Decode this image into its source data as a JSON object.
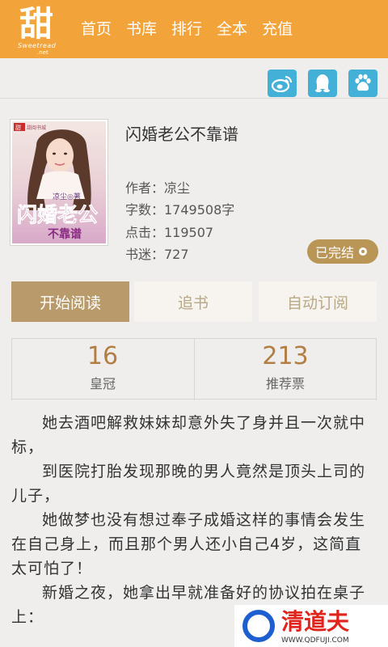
{
  "header": {
    "logo_text": "甜",
    "logo_sub": "Sweetread",
    "logo_sub2": ".net",
    "nav": [
      "首页",
      "书库",
      "排行",
      "全本",
      "充值"
    ]
  },
  "share_icons": [
    "weibo-icon",
    "qq-icon",
    "baidu-icon"
  ],
  "book": {
    "title": "闪婚老公不靠谱",
    "cover_author": "凉尘◎著",
    "cover_title_line1": "闪婚老公",
    "cover_title_line2": "不靠谱",
    "author": "作者：凉尘",
    "words": "字数：1749508字",
    "clicks": "点击：119507",
    "fans": "书迷：727",
    "status": "已完结"
  },
  "actions": {
    "read": "开始阅读",
    "follow": "追书",
    "auto_subscribe": "自动订阅"
  },
  "stats": [
    {
      "value": "16",
      "label": "皇冠"
    },
    {
      "value": "213",
      "label": "推荐票"
    }
  ],
  "intro": [
    "她去酒吧解救妹妹却意外失了身并且一次就中标，",
    "到医院打胎发现那晚的男人竟然是顶头上司的儿子，",
    "她做梦也没有想过奉子成婚这样的事情会发生在自己身上，而且那个男人还小自己4岁，这简直太可怕了！",
    "新婚之夜，她拿出早就准备好的协议拍在桌子上："
  ],
  "watermark": {
    "text": "清道夫",
    "url": "WWW.QDFUJI.COM"
  },
  "colors": {
    "header": "#f2a33a",
    "accent": "#b99a6a",
    "stat_number": "#b27e44",
    "share_button": "#43b0d8"
  }
}
